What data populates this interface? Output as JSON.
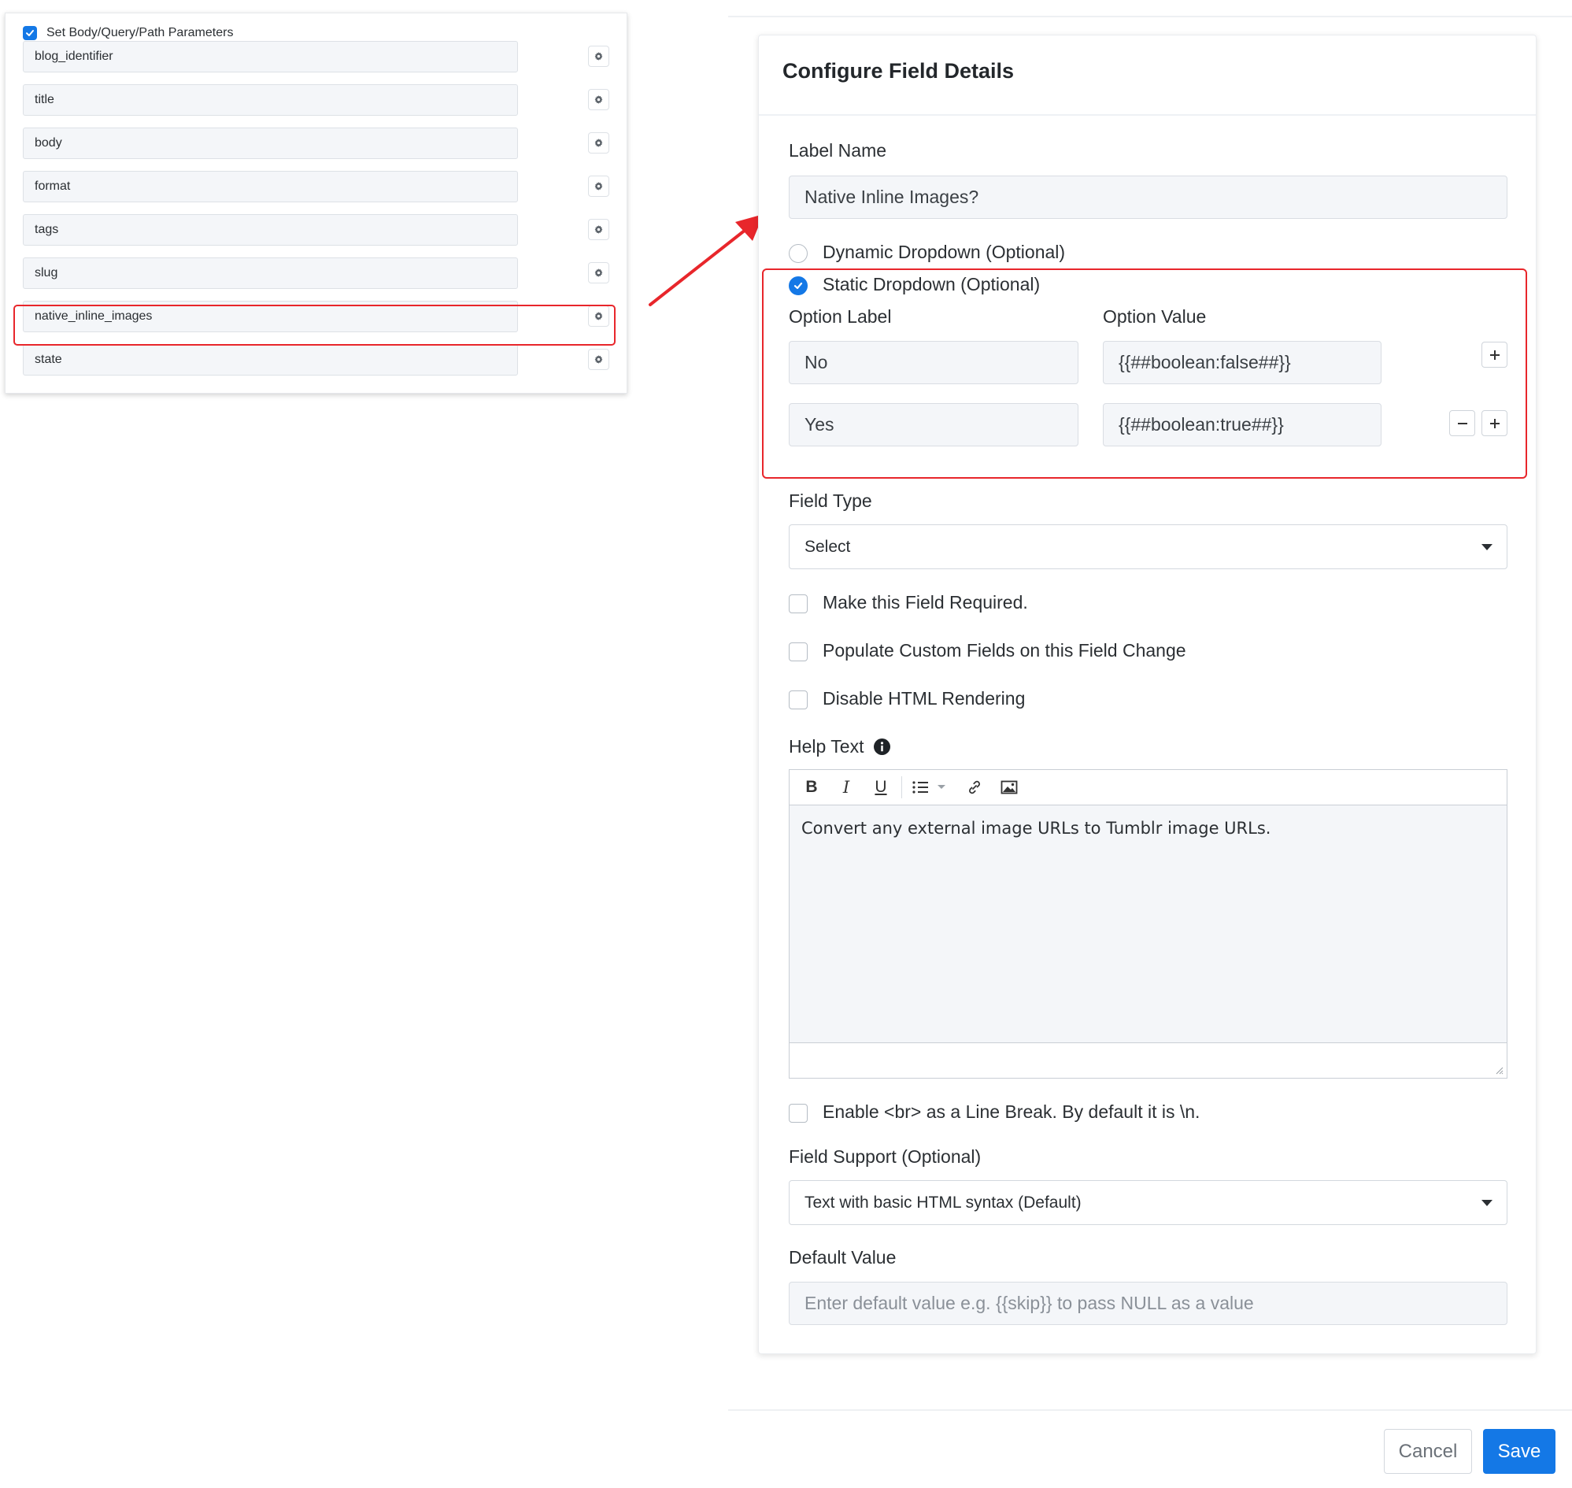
{
  "left_panel": {
    "header_label": "Set Body/Query/Path Parameters",
    "header_checked": true,
    "params": [
      "blog_identifier",
      "title",
      "body",
      "format",
      "tags",
      "slug",
      "native_inline_images",
      "state"
    ],
    "highlighted_param": "native_inline_images"
  },
  "dialog": {
    "title": "Configure Field Details",
    "label_name": {
      "label": "Label Name",
      "value": "Native Inline Images?"
    },
    "dropdown_options": {
      "dynamic_label": "Dynamic Dropdown (Optional)",
      "static_label": "Static Dropdown (Optional)",
      "selected": "static"
    },
    "option_table": {
      "label_header": "Option Label",
      "value_header": "Option Value",
      "rows": [
        {
          "label": "No",
          "value": "{{##boolean:false##}}"
        },
        {
          "label": "Yes",
          "value": "{{##boolean:true##}}"
        }
      ]
    },
    "field_type": {
      "label": "Field Type",
      "value": "Select"
    },
    "checkboxes": {
      "required": "Make this Field Required.",
      "populate": "Populate Custom Fields on this Field Change",
      "disable_html": "Disable HTML Rendering"
    },
    "help_text": {
      "label": "Help Text",
      "toolbar": {
        "bold": "B",
        "italic": "I",
        "underline": "U"
      },
      "content": "Convert any external image URLs to Tumblr image URLs."
    },
    "line_break_label": "Enable <br> as a Line Break. By default it is \\n.",
    "field_support": {
      "label": "Field Support (Optional)",
      "value": "Text with basic HTML syntax (Default)"
    },
    "default_value": {
      "label": "Default Value",
      "placeholder": "Enter default value e.g. {{skip}} to pass NULL as a value"
    }
  },
  "footer": {
    "cancel_label": "Cancel",
    "save_label": "Save"
  },
  "colors": {
    "primary": "#1478e6",
    "highlight": "#e8262b"
  }
}
